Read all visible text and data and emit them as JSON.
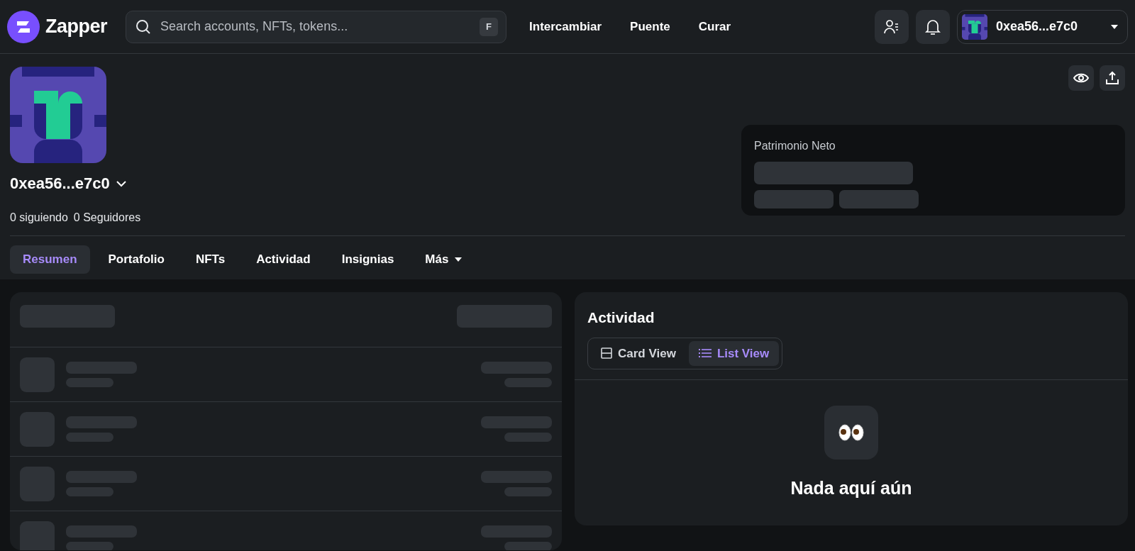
{
  "header": {
    "logo_text": "Zapper",
    "search": {
      "placeholder": "Search accounts, NFTs, tokens...",
      "shortcut": "F"
    },
    "nav": [
      "Intercambiar",
      "Puente",
      "Curar"
    ],
    "account": {
      "address": "0xea56...e7c0"
    }
  },
  "profile": {
    "address": "0xea56...e7c0",
    "following": "0 siguiendo",
    "followers": "0 Seguidores",
    "net_worth": {
      "label": "Patrimonio Neto"
    }
  },
  "tabs": [
    {
      "label": "Resumen",
      "selected": true
    },
    {
      "label": "Portafolio",
      "selected": false
    },
    {
      "label": "NFTs",
      "selected": false
    },
    {
      "label": "Actividad",
      "selected": false
    },
    {
      "label": "Insignias",
      "selected": false
    },
    {
      "label": "Más",
      "selected": false,
      "kind": "dropdown"
    }
  ],
  "activity": {
    "title": "Actividad",
    "views": [
      {
        "label": "Card View",
        "kind": "card",
        "selected": false
      },
      {
        "label": "List View",
        "kind": "list",
        "selected": true
      }
    ],
    "empty_text": "Nada aquí aún"
  }
}
